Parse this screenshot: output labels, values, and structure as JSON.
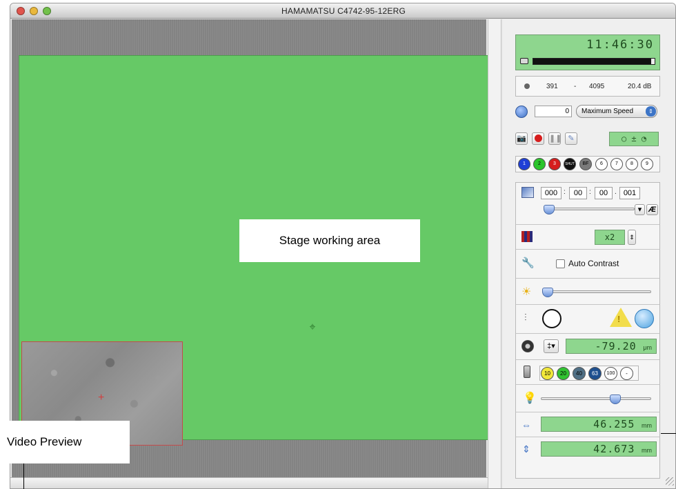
{
  "window": {
    "title": "HAMAMATSU C4742-95-12ERG"
  },
  "colors": {
    "stage": "#66c966",
    "lcd": "#8ed68e",
    "record": "#d61d1d",
    "accent_blue": "#3d75c7"
  },
  "preview": {
    "label": "Video Preview"
  },
  "stage": {
    "label": "Stage working area"
  },
  "panel": {
    "clock": "11:46:30",
    "record_progress": 0.97,
    "levels": {
      "min": "391",
      "dash": "-",
      "max": "4095",
      "gain": "20.4 dB"
    },
    "speed": {
      "value": "0",
      "select": "Maximum Speed"
    },
    "channels": [
      "1",
      "2",
      "3",
      "SHUT",
      "BF",
      "6",
      "7",
      "8",
      "9"
    ],
    "timelapse": {
      "h": "000",
      "m": "00",
      "s": "00",
      "ms": "001",
      "sep1": ":",
      "sep2": ":",
      "sep3": ".",
      "ae": "Æ"
    },
    "binning": "x2",
    "auto_contrast": "Auto Contrast",
    "focus": {
      "value": "-79.20",
      "unit": "μm"
    },
    "objectives": [
      "10",
      "20",
      "40",
      "63",
      "100",
      "-"
    ],
    "stage_x": {
      "value": "46.255",
      "unit": "mm"
    },
    "stage_y": {
      "value": "42.673",
      "unit": "mm"
    }
  }
}
